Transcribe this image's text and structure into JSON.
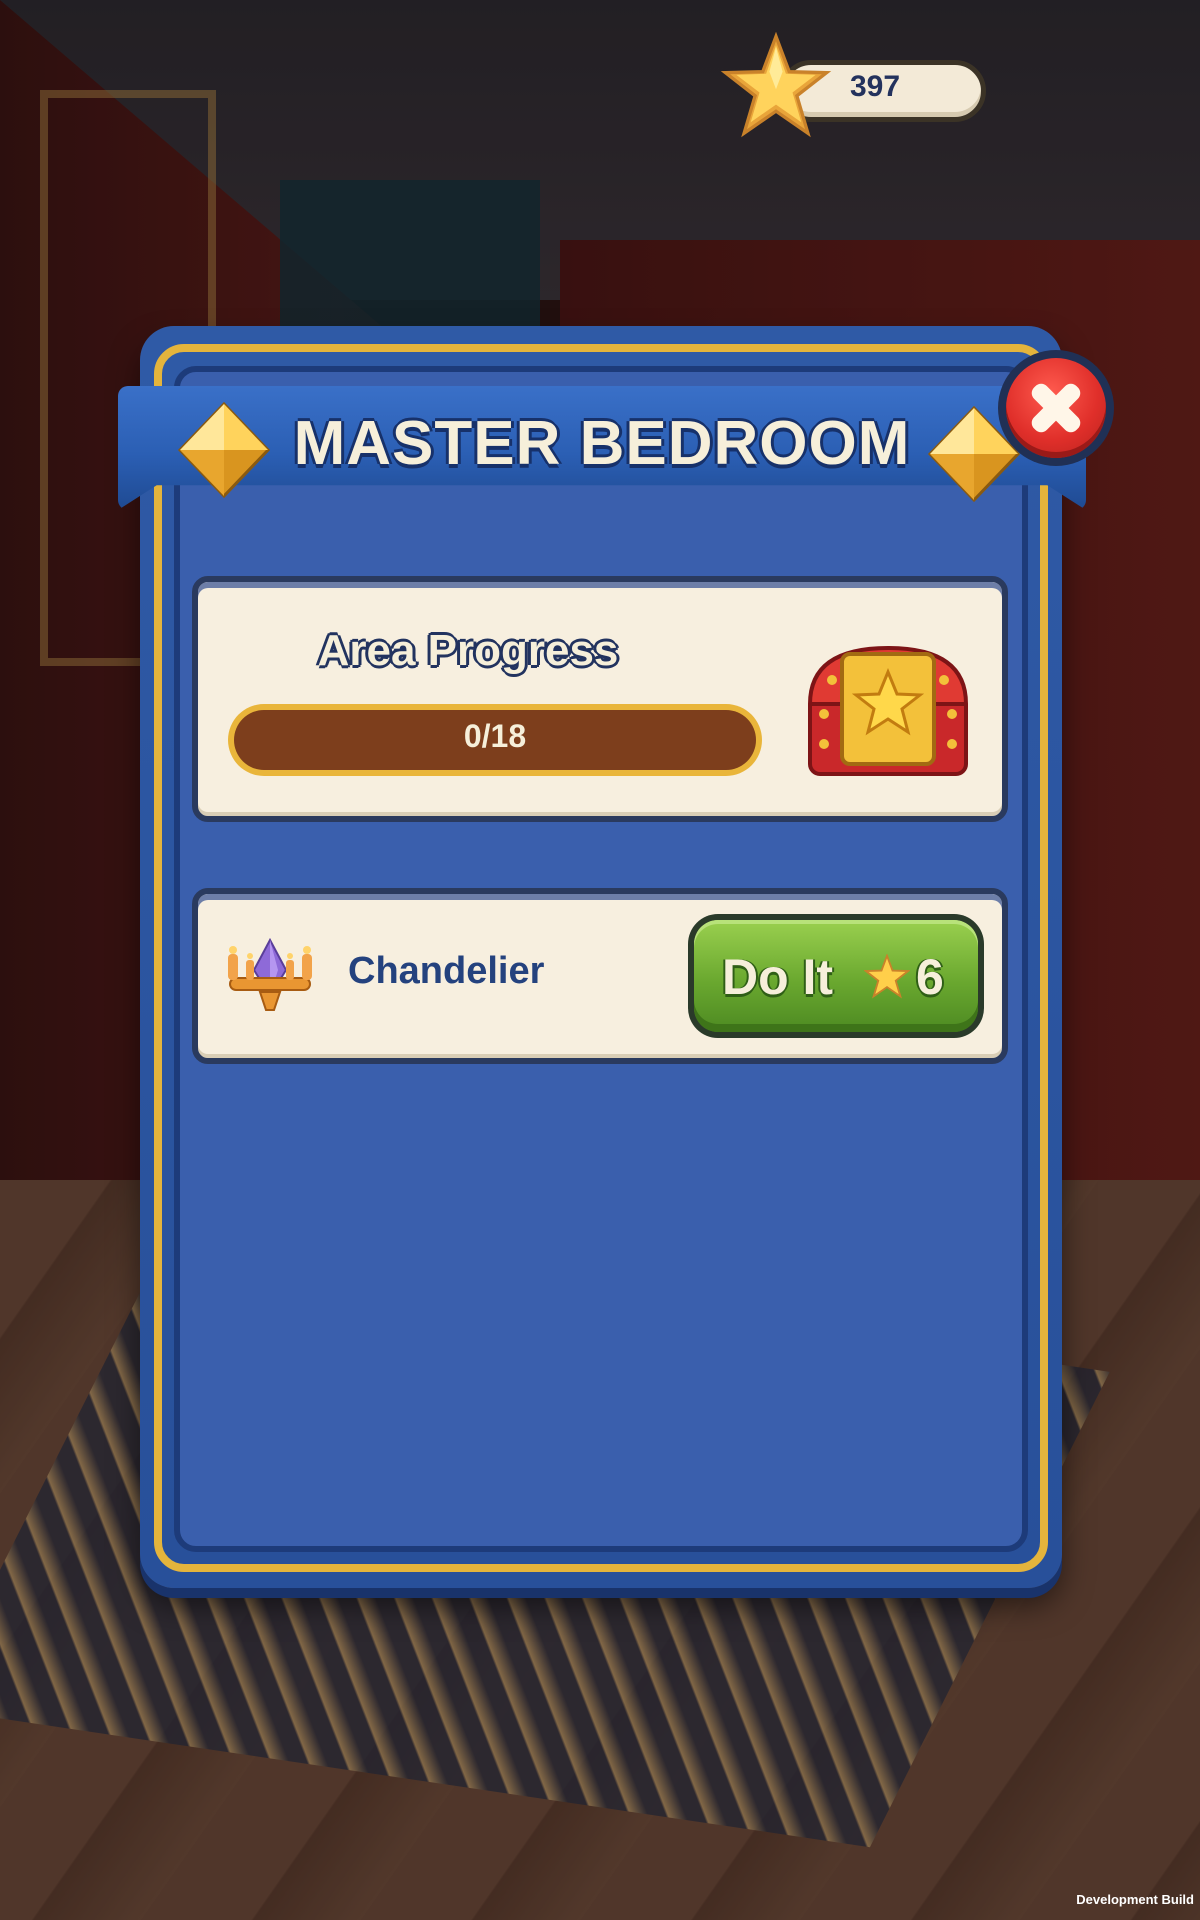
{
  "hud": {
    "star_count": "397",
    "star_icon": "star-icon"
  },
  "dialog": {
    "title": "MASTER BEDROOM",
    "close_icon": "close-icon",
    "area_progress": {
      "title": "Area Progress",
      "label": "0/18",
      "completed": 0,
      "total": 18,
      "reward_icon": "treasure-chest-icon"
    },
    "tasks": [
      {
        "name": "Chandelier",
        "icon": "chandelier-icon",
        "button_label": "Do It",
        "cost": "6",
        "cost_icon": "star-icon"
      }
    ]
  },
  "footer": {
    "build_label": "Development Build"
  },
  "colors": {
    "dialog_blue": "#2f5aa6",
    "gold_trim": "#e4b43c",
    "button_green": "#6aa82f",
    "close_red": "#e02f2a",
    "progress_track": "#7d3e1c"
  }
}
